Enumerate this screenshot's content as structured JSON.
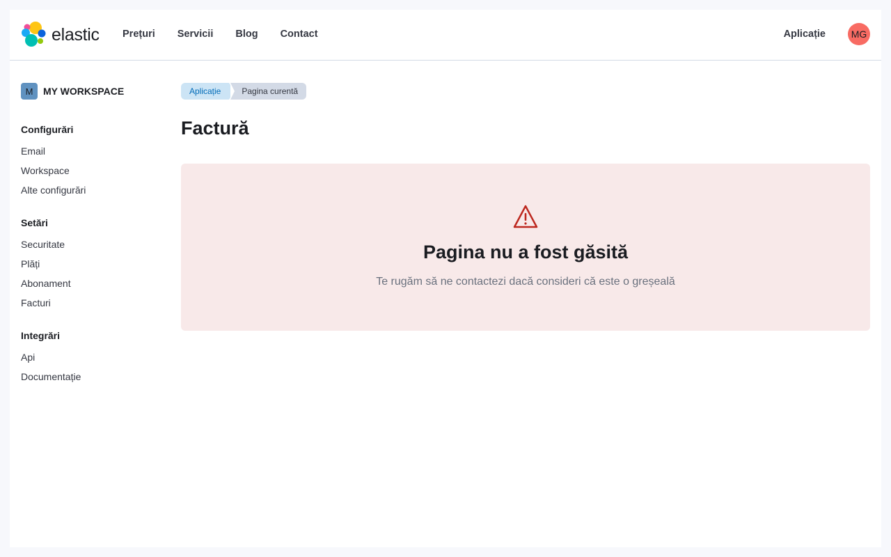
{
  "header": {
    "brand": "elastic",
    "nav": [
      {
        "label": "Prețuri"
      },
      {
        "label": "Servicii"
      },
      {
        "label": "Blog"
      },
      {
        "label": "Contact"
      }
    ],
    "app_link": "Aplicație",
    "avatar_initials": "MG",
    "avatar_color": "#f86b63"
  },
  "sidebar": {
    "workspace": {
      "badge": "M",
      "name": "MY WORKSPACE"
    },
    "groups": [
      {
        "title": "Configurări",
        "items": [
          {
            "label": "Email"
          },
          {
            "label": "Workspace"
          },
          {
            "label": "Alte configurări"
          }
        ]
      },
      {
        "title": "Setări",
        "items": [
          {
            "label": "Securitate"
          },
          {
            "label": "Plăți"
          },
          {
            "label": "Abonament"
          },
          {
            "label": "Facturi"
          }
        ]
      },
      {
        "title": "Integrări",
        "items": [
          {
            "label": "Api"
          },
          {
            "label": "Documentație"
          }
        ]
      }
    ]
  },
  "main": {
    "breadcrumbs": [
      {
        "label": "Aplicație"
      },
      {
        "label": "Pagina curentă"
      }
    ],
    "title": "Factură",
    "error": {
      "icon": "warning-icon",
      "title": "Pagina nu a fost găsită",
      "text": "Te rugăm să ne contactezi dacă consideri că este o greșeală",
      "color": "#bd271e",
      "background": "#f8e9e9"
    }
  }
}
